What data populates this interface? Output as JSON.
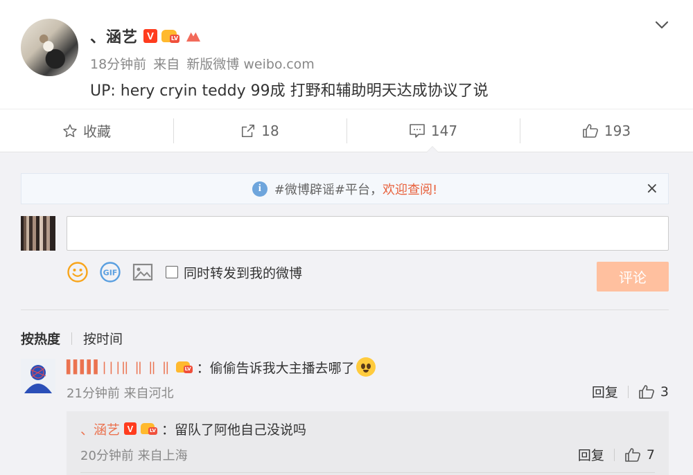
{
  "post": {
    "author": "、涵艺",
    "time": "18分钟前",
    "source_prefix": "来自",
    "source": "新版微博 weibo.com",
    "text": "UP: hery cryin teddy 99成 打野和辅助明天达成协议了说",
    "badge_v": "V",
    "badge_level": "LV"
  },
  "actions": {
    "favorite_label": "收藏",
    "repost_count": "18",
    "comment_count": "147",
    "like_count": "193"
  },
  "notice": {
    "text": "#微博辟谣#平台，",
    "link": "欢迎查阅!",
    "close": "×"
  },
  "composer": {
    "input_value": "",
    "repost_label": "同时转发到我的微博",
    "submit_label": "评论"
  },
  "sort": {
    "hot_label": "按热度",
    "time_label": "按时间"
  },
  "comments": [
    {
      "name": "▌▌▌▌▌|||‖ ‖ ‖ ‖",
      "text": "：偷偷告诉我大主播去哪了",
      "time": "21分钟前",
      "location": "来自河北",
      "reply_label": "回复",
      "likes": "3",
      "reply": {
        "name": "、涵艺",
        "text": "：留队了阿他自己没说吗",
        "time": "20分钟前",
        "location": "来自上海",
        "reply_label": "回复",
        "likes": "7"
      }
    }
  ],
  "colors": {
    "accent": "#eb7350",
    "vip": "#ff3c1e",
    "submit_disabled": "#ffc09f",
    "info": "#6ea5dc"
  }
}
